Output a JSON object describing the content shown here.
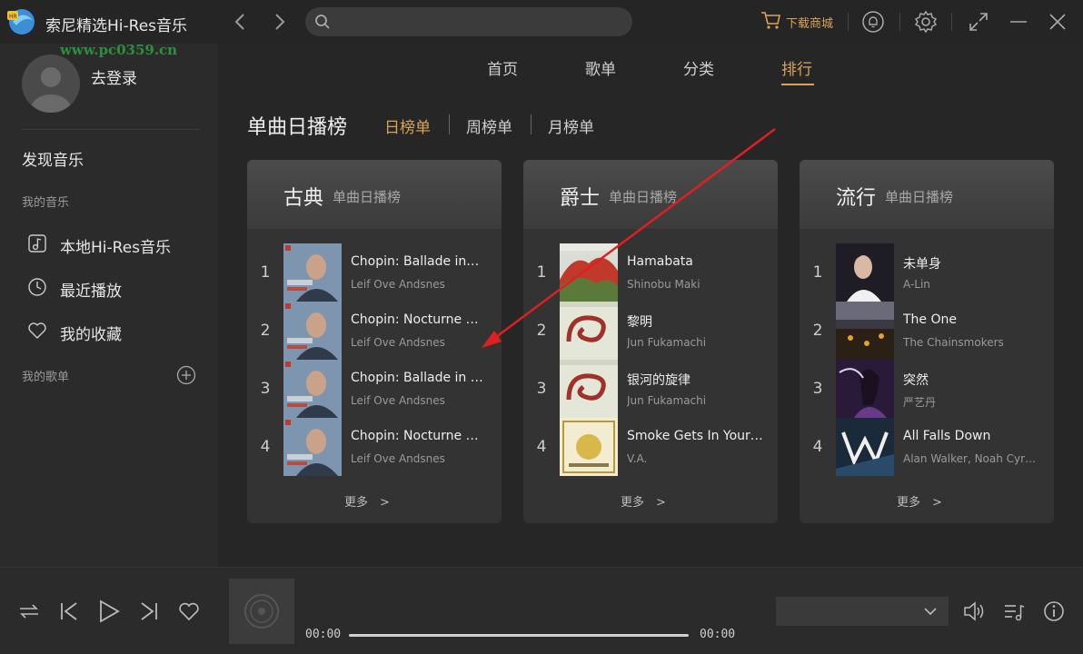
{
  "app": {
    "title": "索尼精选Hi-Res音乐",
    "watermark": "www.pc0359.cn",
    "accent_color": "#d9a45a"
  },
  "search": {
    "placeholder": "",
    "value": ""
  },
  "toolbar": {
    "store_label": "下载商城",
    "icons": [
      "back-arrow-icon",
      "forward-arrow-icon",
      "search-icon",
      "cart-icon",
      "notification-bell-icon",
      "settings-gear-icon",
      "fullscreen-icon",
      "minimize-icon",
      "close-icon"
    ]
  },
  "sidebar": {
    "login_label": "去登录",
    "discover_label": "发现音乐",
    "my_music_label": "我的音乐",
    "items": [
      {
        "label": "本地Hi-Res音乐",
        "icon": "local-music-icon"
      },
      {
        "label": "最近播放",
        "icon": "clock-icon"
      },
      {
        "label": "我的收藏",
        "icon": "heart-icon"
      }
    ],
    "my_playlists_label": "我的歌单"
  },
  "tabs": [
    {
      "label": "首页",
      "active": false
    },
    {
      "label": "歌单",
      "active": false
    },
    {
      "label": "分类",
      "active": false
    },
    {
      "label": "排行",
      "active": true
    }
  ],
  "chart": {
    "heading": "单曲日播榜",
    "periods": [
      {
        "label": "日榜单",
        "active": true
      },
      {
        "label": "周榜单",
        "active": false
      },
      {
        "label": "月榜单",
        "active": false
      }
    ]
  },
  "cards": [
    {
      "genre": "古典",
      "subtitle": "单曲日播榜",
      "more_label": "更多　>",
      "songs": [
        {
          "rank": "1",
          "title": "Chopin: Ballade in…",
          "artist": "Leif Ove Andsnes"
        },
        {
          "rank": "2",
          "title": "Chopin: Nocturne N…",
          "artist": "Leif Ove Andsnes"
        },
        {
          "rank": "3",
          "title": "Chopin: Ballade in F…",
          "artist": "Leif Ove Andsnes"
        },
        {
          "rank": "4",
          "title": "Chopin: Nocturne N…",
          "artist": "Leif Ove Andsnes"
        }
      ]
    },
    {
      "genre": "爵士",
      "subtitle": "单曲日播榜",
      "more_label": "更多　>",
      "songs": [
        {
          "rank": "1",
          "title": "Hamabata",
          "artist": "Shinobu Maki"
        },
        {
          "rank": "2",
          "title": "黎明",
          "artist": "Jun Fukamachi"
        },
        {
          "rank": "3",
          "title": "银河的旋律",
          "artist": "Jun Fukamachi"
        },
        {
          "rank": "4",
          "title": "Smoke Gets In Your…",
          "artist": "V.A."
        }
      ]
    },
    {
      "genre": "流行",
      "subtitle": "单曲日播榜",
      "more_label": "更多　>",
      "songs": [
        {
          "rank": "1",
          "title": "未单身",
          "artist": "A-Lin"
        },
        {
          "rank": "2",
          "title": "The One",
          "artist": "The Chainsmokers"
        },
        {
          "rank": "3",
          "title": "突然",
          "artist": "严艺丹"
        },
        {
          "rank": "4",
          "title": "All Falls Down",
          "artist": "Alan Walker, Noah Cyru…"
        }
      ]
    }
  ],
  "player": {
    "current_time": "00:00",
    "total_time": "00:00",
    "progress_fraction": 0,
    "output_select_value": "",
    "icons": [
      "loop-icon",
      "previous-icon",
      "play-icon",
      "next-icon",
      "like-heart-icon",
      "volume-icon",
      "playlist-icon",
      "info-icon"
    ]
  }
}
